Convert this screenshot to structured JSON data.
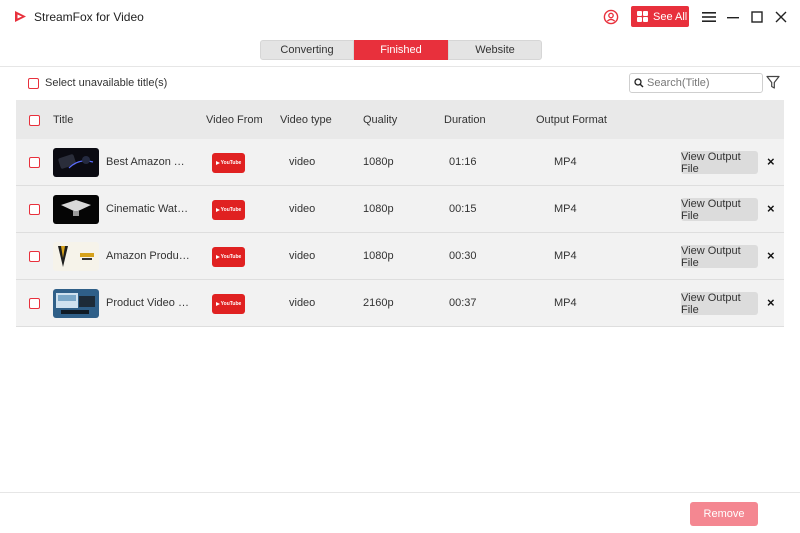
{
  "app": {
    "title": "StreamFox for Video"
  },
  "header": {
    "see_all_label": "See All"
  },
  "tabs": [
    {
      "label": "Converting",
      "active": false
    },
    {
      "label": "Finished",
      "active": true
    },
    {
      "label": "Website",
      "active": false
    }
  ],
  "filter": {
    "select_unavailable_label": "Select unavailable title(s)",
    "search_placeholder": "Search(Title)"
  },
  "table": {
    "columns": {
      "title": "Title",
      "video_from": "Video From",
      "video_type": "Video type",
      "quality": "Quality",
      "duration": "Duration",
      "output_format": "Output Format"
    },
    "source_badge": "YouTube",
    "view_output_label": "View Output File",
    "rows": [
      {
        "title": "Best Amazon Tec...",
        "type": "video",
        "quality": "1080p",
        "duration": "01:16",
        "format": "MP4"
      },
      {
        "title": "Cinematic Watch ...",
        "type": "video",
        "quality": "1080p",
        "duration": "00:15",
        "format": "MP4"
      },
      {
        "title": "Amazon Product ...",
        "type": "video",
        "quality": "1080p",
        "duration": "00:30",
        "format": "MP4"
      },
      {
        "title": "Product Video Stu...",
        "type": "video",
        "quality": "2160p",
        "duration": "00:37",
        "format": "MP4"
      }
    ]
  },
  "footer": {
    "remove_label": "Remove"
  },
  "colors": {
    "accent": "#e8303c",
    "remove_disabled": "#f48791",
    "youtube": "#e02121"
  },
  "icons": [
    "streamfox-logo-icon",
    "user-icon",
    "grid-icon",
    "menu-icon",
    "minimize-icon",
    "maximize-icon",
    "close-icon",
    "search-icon",
    "filter-icon",
    "youtube-icon",
    "remove-x-icon"
  ]
}
